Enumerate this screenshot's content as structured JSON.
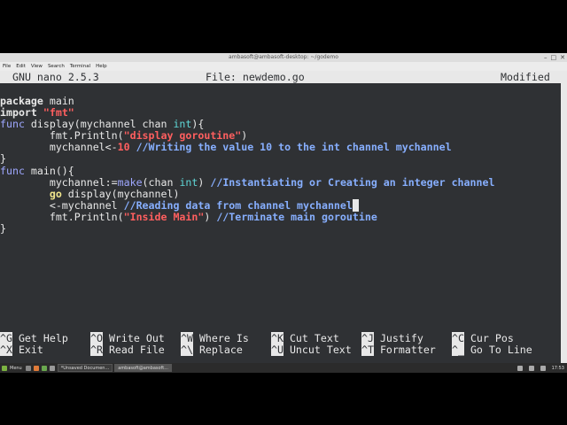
{
  "window": {
    "title": "ambasoft@ambasoft-desktop: ~/godemo"
  },
  "menu": [
    "File",
    "Edit",
    "View",
    "Search",
    "Terminal",
    "Help"
  ],
  "nano": {
    "version": "GNU nano 2.5.3",
    "file": "File: newdemo.go",
    "status": "Modified"
  },
  "code": {
    "l1_kw": "package",
    "l1_rest": " main",
    "l2_kw": "import",
    "l2_str": "\"fmt\"",
    "l3_kw": "func",
    "l3_rest": " display(mychannel chan ",
    "l3_type": "int",
    "l3_end": "){",
    "l4_indent": "        ",
    "l4_call": "fmt.Println(",
    "l4_str": "\"display goroutine\"",
    "l4_end": ")",
    "l5_indent": "        ",
    "l5_code": "mychannel<-",
    "l5_num": "10",
    "l5_comment": " //Writing the value 10 to the int channel mychannel",
    "l6": "}",
    "l7_kw": "func",
    "l7_rest": " main(){",
    "l8_indent": "        ",
    "l8_code": "mychannel:=",
    "l8_make": "make",
    "l8_rest": "(chan ",
    "l8_type": "int",
    "l8_end": ") ",
    "l8_comment": "//Instantiating or Creating an integer channel",
    "l9_indent": "        ",
    "l9_kw": "go",
    "l9_rest": " display(mychannel)",
    "l10_indent": "        ",
    "l10_code": "<-mychannel ",
    "l10_comment": "//Reading data from channel mychannel",
    "l11_indent": "        ",
    "l11_call": "fmt.Println(",
    "l11_str": "\"Inside Main\"",
    "l11_end": ") ",
    "l11_comment": "//Terminate main goroutine",
    "l12": "}"
  },
  "shortcuts": {
    "row1": [
      {
        "key": "^G",
        "label": "Get Help"
      },
      {
        "key": "^O",
        "label": "Write Out"
      },
      {
        "key": "^W",
        "label": "Where Is"
      },
      {
        "key": "^K",
        "label": "Cut Text"
      },
      {
        "key": "^J",
        "label": "Justify"
      },
      {
        "key": "^C",
        "label": "Cur Pos"
      }
    ],
    "row2": [
      {
        "key": "^X",
        "label": "Exit"
      },
      {
        "key": "^R",
        "label": "Read File"
      },
      {
        "key": "^\\",
        "label": "Replace"
      },
      {
        "key": "^U",
        "label": "Uncut Text"
      },
      {
        "key": "^T",
        "label": "Formatter"
      },
      {
        "key": "^_",
        "label": "Go To Line"
      }
    ]
  },
  "taskbar": {
    "menu": "Menu",
    "task1": "*Unsaved Documen...",
    "task2": "ambasoft@ambasoft...",
    "clock": "17:53"
  }
}
